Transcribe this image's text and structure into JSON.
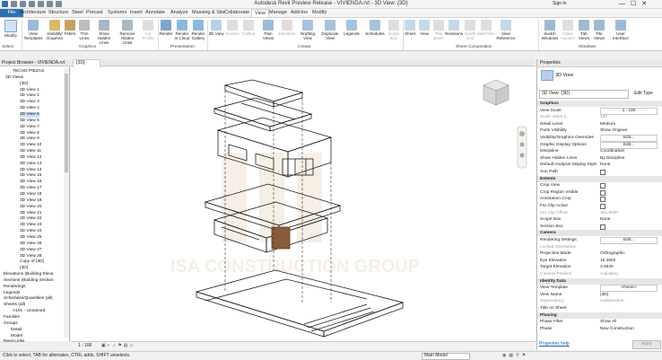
{
  "app": {
    "title": "Autodesk Revit Preview Release - VIVIENDA.rvt - 3D View: {3D}",
    "user": "Sign In"
  },
  "tabs": [
    "File",
    "Architecture",
    "Structure",
    "Steel",
    "Precast",
    "Systems",
    "Insert",
    "Annotate",
    "Analyze",
    "Massing & Site",
    "Collaborate",
    "View",
    "Manage",
    "Add-Ins",
    "Modify"
  ],
  "ribbon": {
    "buttons": [
      "Modify",
      "View Templates",
      "Visibility/ Graphics",
      "Filters",
      "Thin Lines",
      "Show Hidden Lines",
      "Remove Hidden Lines",
      "Cut Profile",
      "Render",
      "Render in Cloud",
      "Render Gallery",
      "3D View",
      "Section",
      "Callout",
      "Plan Views",
      "Elevation",
      "Drafting View",
      "Duplicate View",
      "Legends",
      "Schedules",
      "Scope Box",
      "Sheet",
      "View",
      "Title Block",
      "Revisions",
      "Guide Grid",
      "Matchline",
      "View Reference",
      "Switch Windows",
      "Close Inactive",
      "Tab Views",
      "Tile Views",
      "User Interface"
    ],
    "groups": [
      "Select",
      "Graphics",
      "Presentation",
      "Create",
      "Sheet Composition",
      "Windows"
    ]
  },
  "project_browser": {
    "title": "Project Browser - VIVIENDA.rvt",
    "items": [
      "TECHO PIEZAS",
      "3D Views",
      "{3D}",
      "3D View 1",
      "3D View 2",
      "3D View 3",
      "3D View 4",
      "3D View 5",
      "3D View 6",
      "3D View 7",
      "3D View 8",
      "3D View 9",
      "3D View 10",
      "3D View 11",
      "3D View 12",
      "3D View 13",
      "3D View 14",
      "3D View 15",
      "3D View 16",
      "3D View 17",
      "3D View 18",
      "3D View 19",
      "3D View 20",
      "3D View 21",
      "3D View 22",
      "3D View 23",
      "3D View 24",
      "3D View 25",
      "3D View 26",
      "3D View 27",
      "3D View 28",
      "Copy of {3D}",
      "{3D}",
      "Elevations (Building Eleva",
      "Sections (Building Section",
      "Renderings",
      "Legends",
      "Schedules/Quantities (all)",
      "Sheets (all)",
      "A101 - Unnamed",
      "Families",
      "Groups",
      "Detail",
      "Model",
      "Revit Links"
    ],
    "selected_index": 7
  },
  "view_tab": "{3D}",
  "view_bar": {
    "scale": "1 : 100"
  },
  "properties": {
    "title": "Properties",
    "type_name": "3D View",
    "selector": "3D View: {3D}",
    "edit_type": "Edit Type",
    "rows": [
      {
        "k": "Graphics",
        "head": true
      },
      {
        "k": "View Scale",
        "v": "1 : 100",
        "box": true
      },
      {
        "k": "Scale Value    1:",
        "v": "100",
        "grey": true
      },
      {
        "k": "Detail Level",
        "v": "Medium"
      },
      {
        "k": "Parts Visibility",
        "v": "Show Original"
      },
      {
        "k": "Visibility/Graphics Overrides",
        "v": "Edit...",
        "box": true
      },
      {
        "k": "Graphic Display Options",
        "v": "Edit...",
        "box": true
      },
      {
        "k": "Discipline",
        "v": "Coordination"
      },
      {
        "k": "Show Hidden Lines",
        "v": "By Discipline"
      },
      {
        "k": "Default Analysis Display Style",
        "v": "None"
      },
      {
        "k": "Sun Path",
        "chk": true
      },
      {
        "k": "Extents",
        "head": true
      },
      {
        "k": "Crop View",
        "chk": true
      },
      {
        "k": "Crop Region Visible",
        "chk": true
      },
      {
        "k": "Annotation Crop",
        "chk": true
      },
      {
        "k": "Far Clip Active",
        "chk": true
      },
      {
        "k": "Far Clip Offset",
        "v": "304.8000",
        "grey": true
      },
      {
        "k": "Scope Box",
        "v": "None"
      },
      {
        "k": "Section Box",
        "chk": true
      },
      {
        "k": "Camera",
        "head": true
      },
      {
        "k": "Rendering Settings",
        "v": "Edit...",
        "box": true
      },
      {
        "k": "Locked Orientation",
        "grey": true
      },
      {
        "k": "Projection Mode",
        "v": "Orthographic"
      },
      {
        "k": "Eye Elevation",
        "v": "15.4662"
      },
      {
        "k": "Target Elevation",
        "v": "3.4840"
      },
      {
        "k": "Camera Position",
        "v": "Adjusting",
        "grey": true
      },
      {
        "k": "Identity Data",
        "head": true
      },
      {
        "k": "View Template",
        "v": "<None>",
        "box": true
      },
      {
        "k": "View Name",
        "v": "{3D}"
      },
      {
        "k": "Dependency",
        "v": "Independent",
        "grey": true
      },
      {
        "k": "Title on Sheet"
      },
      {
        "k": "Phasing",
        "head": true
      },
      {
        "k": "Phase Filter",
        "v": "Show All"
      },
      {
        "k": "Phase",
        "v": "New Construction"
      }
    ],
    "help_link": "Properties help",
    "apply": "Apply"
  },
  "status": {
    "hint": "Click to select, TAB for alternates, CTRL adds, SHIFT unselects.",
    "model": "Main Model"
  },
  "watermark": "ISA CONSTRUCTION GROUP",
  "colors": {
    "file_tab": "#2f6fb5",
    "selection": "#cde3f7",
    "building_lines": "#1a1a1a"
  }
}
